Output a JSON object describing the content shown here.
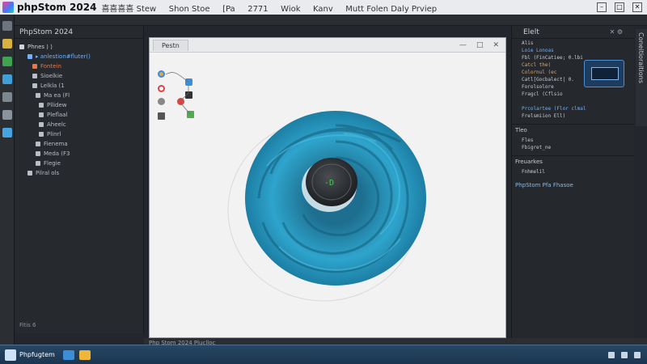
{
  "titlebar": {
    "app": "phpStom 2024",
    "menu": [
      "喜喜喜喜 Stew",
      "Shon Stoe",
      "[Pa",
      "2771",
      "Wiok",
      "Kanv",
      "Mutt Folen Daly Prviep"
    ]
  },
  "project": {
    "header": "PhpStom 2024",
    "rows": [
      {
        "text": "Phnes ⟩ ⟩",
        "indent": 0,
        "color": "#d0d4da"
      },
      {
        "text": "▸ anlestion#fluter()",
        "indent": 10,
        "color": "#6fb2ff"
      },
      {
        "text": "Fontein",
        "indent": 16,
        "color": "#e07a4a"
      },
      {
        "text": "Sioelkie",
        "indent": 16,
        "color": "#b9bec5"
      },
      {
        "text": "Lelkla (1",
        "indent": 16,
        "color": "#b9bec5"
      },
      {
        "text": "Ma ea (Fl",
        "indent": 20,
        "color": "#b9bec5"
      },
      {
        "text": "Pllidew",
        "indent": 24,
        "color": "#b9bec5"
      },
      {
        "text": "Pleflaal",
        "indent": 24,
        "color": "#b9bec5"
      },
      {
        "text": "Aheelc",
        "indent": 24,
        "color": "#b9bec5"
      },
      {
        "text": "Plinrl",
        "indent": 24,
        "color": "#b9bec5"
      },
      {
        "text": "Fienema",
        "indent": 20,
        "color": "#b9bec5"
      },
      {
        "text": "Meda (F3",
        "indent": 20,
        "color": "#b9bec5"
      },
      {
        "text": "Flegie",
        "indent": 20,
        "color": "#b9bec5"
      },
      {
        "text": "Pilral ols",
        "indent": 10,
        "color": "#b9bec5"
      }
    ],
    "footer": "Fitis 6"
  },
  "preview": {
    "tab": "Pestn",
    "controls": [
      "—",
      "□",
      "✕"
    ]
  },
  "right": {
    "header": "Elelt",
    "code1": [
      {
        "t": "Alis",
        "c": "w"
      },
      {
        "t": "Loie Lonoas",
        "c": "b"
      },
      {
        "t": "Fbl (FinCatiee; 0.lbi",
        "c": "w"
      },
      {
        "t": "Catcl the(",
        "c": "o"
      },
      {
        "t": "Colornul (ec",
        "c": "o"
      },
      {
        "t": "Catl[Gocbalect| 0.",
        "c": "w"
      },
      {
        "t": "Forolsolore",
        "c": "w"
      },
      {
        "t": "Fragcl (Cflsio",
        "c": "w"
      },
      {
        "t": "",
        "c": "w"
      },
      {
        "t": "Prcolartee   (Flor clmal",
        "c": "b"
      },
      {
        "t": "Frelsmiion  Ell)",
        "c": "w"
      }
    ],
    "section2": "Tleo",
    "code2": [
      {
        "t": "Fles",
        "c": "w"
      },
      {
        "t": "Fbigret_ne",
        "c": "w"
      }
    ],
    "section3": "Freuarkes",
    "code3": [
      {
        "t": "Fnhmelil",
        "c": "w"
      }
    ],
    "bottom_line": "PhpStom Pfa Fhasoe"
  },
  "vtab": "Coneitioraitions",
  "statusbar": "Php Stom 2024 Pluclloc",
  "taskbar": {
    "label": "Phpfugtem",
    "icon_colors": [
      "#3a8fd8",
      "#f0b63a"
    ]
  },
  "colors": {
    "accent": "#2e97c2",
    "knob": "#2f3236",
    "led": "#3ed14a"
  }
}
